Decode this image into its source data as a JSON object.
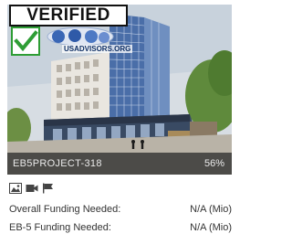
{
  "badge": {
    "title": "VERIFIED",
    "site": "USADVISORS.ORG",
    "check_icon": "check-icon"
  },
  "project": {
    "code": "EB5PROJECT-318",
    "percent": "56%"
  },
  "media_icons": [
    "image-icon",
    "video-camera-icon",
    "flag-icon"
  ],
  "funding": [
    {
      "label": "Overall Funding Needed:",
      "value": "N/A (Mio)"
    },
    {
      "label": "EB-5 Funding Needed:",
      "value": "N/A (Mio)"
    }
  ],
  "colors": {
    "badge_green": "#2e9d35",
    "overlay": "#282828",
    "text": "#333333"
  }
}
